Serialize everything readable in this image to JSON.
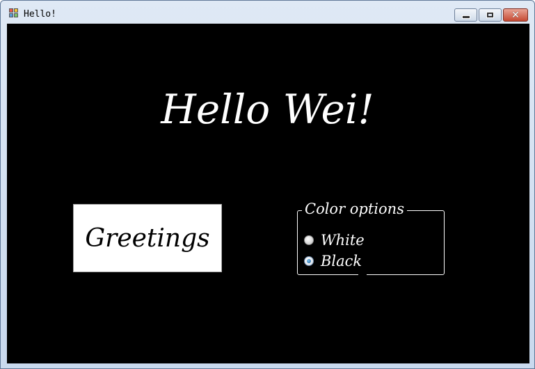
{
  "window": {
    "title": "Hello!",
    "icon": "app-icon",
    "controls": {
      "minimize": "minimize-icon",
      "maximize": "maximize-icon",
      "close": "close-icon"
    },
    "close_glyph": "✕"
  },
  "main": {
    "heading": "Hello Wei!",
    "greet_button_label": "Greetings",
    "background_color": "#000000",
    "text_color": "#ffffff"
  },
  "color_options": {
    "legend": "Color options",
    "options": [
      {
        "label": "White",
        "checked": false
      },
      {
        "label": "Black",
        "checked": true
      }
    ]
  }
}
